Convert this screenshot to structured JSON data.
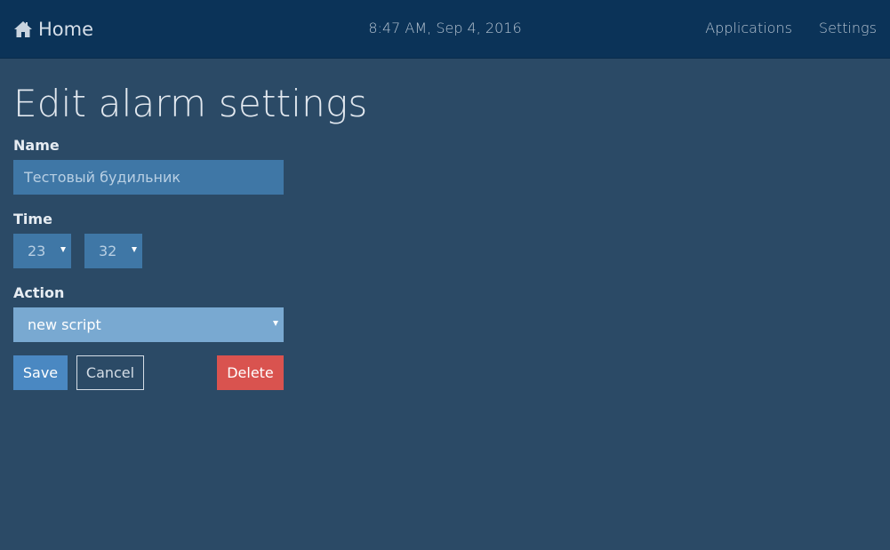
{
  "navbar": {
    "brand_label": "Home",
    "brand_icon": "home-icon",
    "clock_text": "8:47 AM, Sep 4, 2016",
    "links": [
      {
        "label": "Applications"
      },
      {
        "label": "Settings"
      }
    ]
  },
  "page": {
    "title": "Edit alarm settings"
  },
  "form": {
    "name_label": "Name",
    "name_placeholder": "Тестовый будильник",
    "name_value": "",
    "time_label": "Time",
    "time_hour": "23",
    "time_minute": "32",
    "action_label": "Action",
    "action_value": "new script"
  },
  "buttons": {
    "save_label": "Save",
    "cancel_label": "Cancel",
    "delete_label": "Delete"
  },
  "colors": {
    "navbar_bg": "#0b3358",
    "page_bg": "#2b4a66",
    "input_bg": "#3f77a6",
    "action_select_bg": "#79a9d1",
    "save_bg": "#4a88c2",
    "delete_bg": "#d9534f"
  }
}
